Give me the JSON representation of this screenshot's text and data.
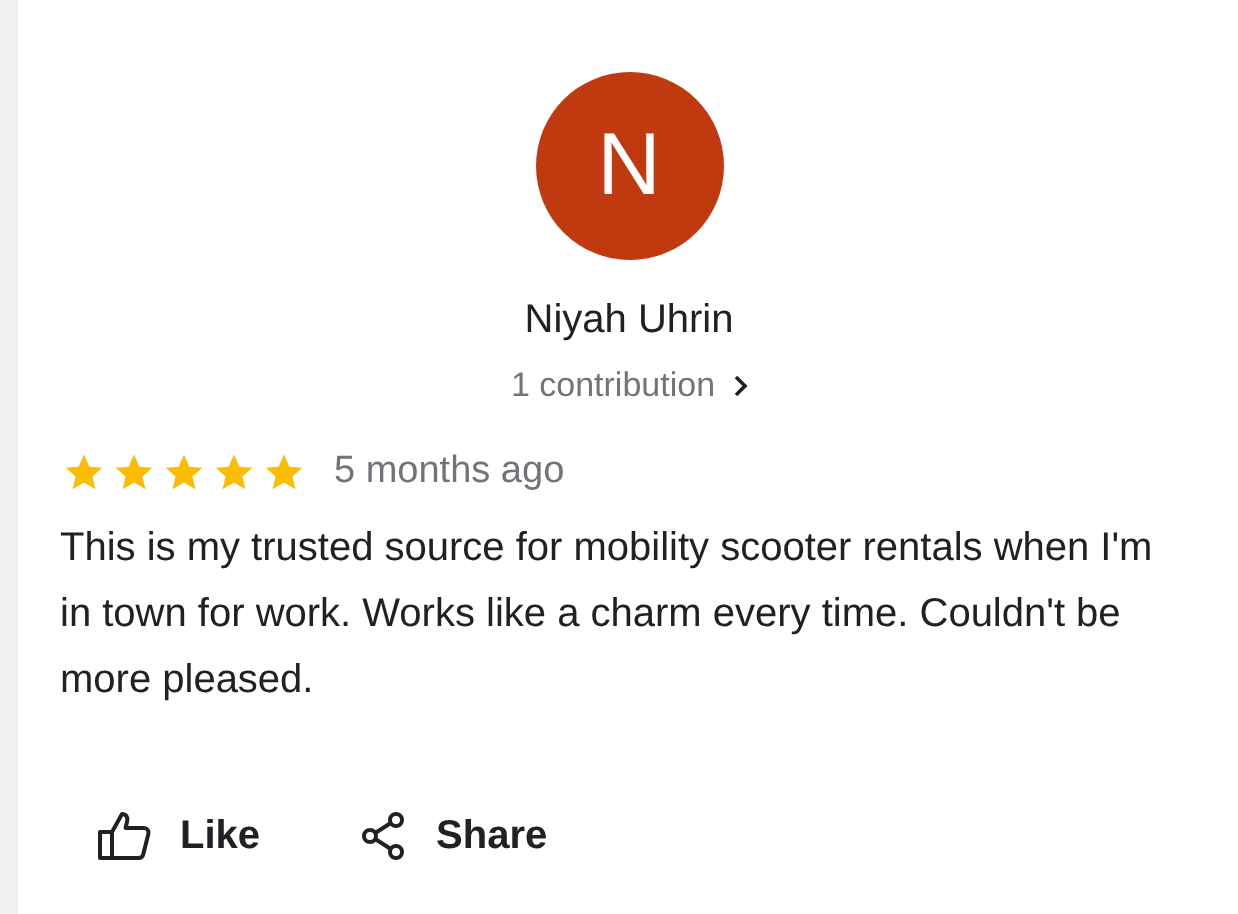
{
  "review": {
    "avatar_letter": "N",
    "author": "Niyah Uhrin",
    "contributions": "1 contribution",
    "stars": 5,
    "time": "5 months ago",
    "text": "This is my trusted source for mobility scooter rentals when I'm in town for work. Works like a charm every time. Couldn't be more pleased."
  },
  "actions": [
    {
      "kind": "like",
      "label": "Like"
    },
    {
      "kind": "share",
      "label": "Share"
    }
  ]
}
